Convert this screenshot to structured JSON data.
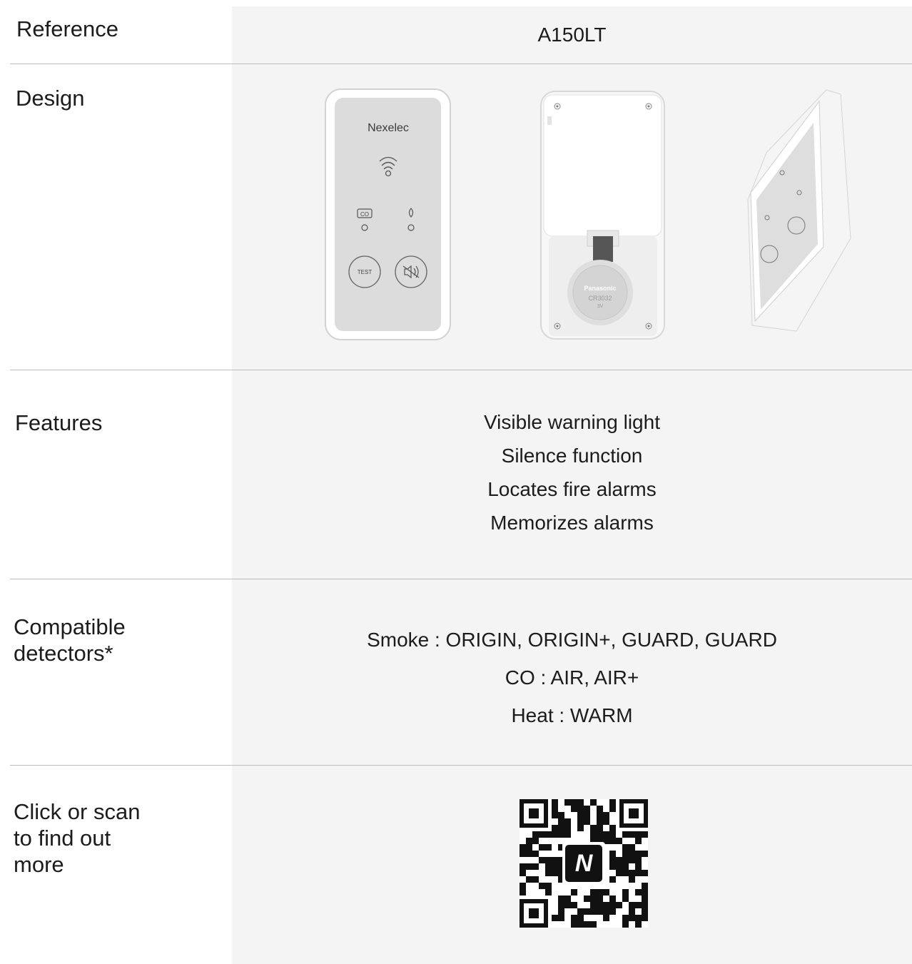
{
  "rows": {
    "reference": {
      "label": "Reference",
      "value": "A150LT"
    },
    "design": {
      "label": "Design",
      "brand": "Nexelec",
      "co_label": "CO",
      "test_label": "TEST",
      "battery_brand": "Panasonic",
      "battery_model": "CR3032",
      "battery_voltage": "3V"
    },
    "features": {
      "label": "Features",
      "items": [
        "Visible warning light",
        "Silence function",
        "Locates fire alarms",
        "Memorizes alarms"
      ]
    },
    "compatible": {
      "label_line1": "Compatible",
      "label_line2": "detectors*",
      "items": [
        "Smoke : ORIGIN, ORIGIN+, GUARD, GUARD",
        "CO : AIR, AIR+",
        "Heat : WARM"
      ]
    },
    "more": {
      "label_line1": "Click or scan",
      "label_line2": "to find out",
      "label_line3": "more",
      "qr_letter": "N"
    }
  },
  "colors": {
    "panel_bg": "#f4f4f4",
    "separator": "#bcbcbc",
    "text": "#1c1c1c",
    "device_face": "#dcdcdc"
  }
}
